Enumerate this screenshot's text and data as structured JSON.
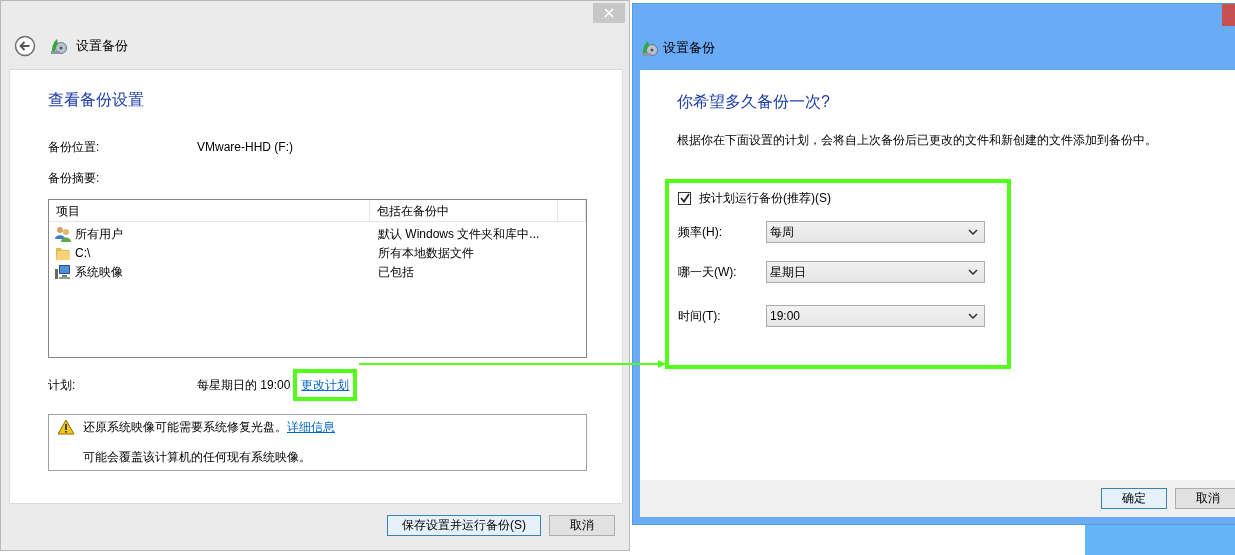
{
  "left_window": {
    "title": "设置备份",
    "heading": "查看备份设置",
    "location": {
      "label": "备份位置:",
      "value": "VMware-HHD (F:)"
    },
    "summary_label": "备份摘要:",
    "table": {
      "columns": [
        "项目",
        "包括在备份中"
      ],
      "rows": [
        {
          "kind": "users",
          "item": "所有用户",
          "included": "默认 Windows 文件夹和库中..."
        },
        {
          "kind": "folder",
          "item": "C:\\",
          "included": "所有本地数据文件"
        },
        {
          "kind": "computer",
          "item": "系统映像",
          "included": "已包括"
        }
      ]
    },
    "schedule": {
      "label": "计划:",
      "value": "每星期日的 19:00",
      "link": "更改计划"
    },
    "warning": {
      "message": "还原系统映像可能需要系统修复光盘。",
      "link": "详细信息",
      "note": "可能会覆盖该计算机的任何现有系统映像。"
    },
    "buttons": [
      {
        "label": "保存设置并运行备份(S)",
        "default": true
      },
      {
        "label": "取消",
        "default": false
      }
    ]
  },
  "right_window": {
    "title": "设置备份",
    "heading": "你希望多久备份一次?",
    "description": "根据你在下面设置的计划，会将自上次备份后已更改的文件和新创建的文件添加到备份中。",
    "checkbox": {
      "label": "按计划运行备份(推荐)(S)",
      "checked": true
    },
    "selects": [
      {
        "label": "频率(H):",
        "value": "每周"
      },
      {
        "label": "哪一天(W):",
        "value": "星期日"
      },
      {
        "label": "时间(T):",
        "value": "19:00"
      }
    ],
    "buttons": [
      {
        "label": "确定",
        "default": true
      },
      {
        "label": "取消",
        "default": false
      }
    ]
  }
}
